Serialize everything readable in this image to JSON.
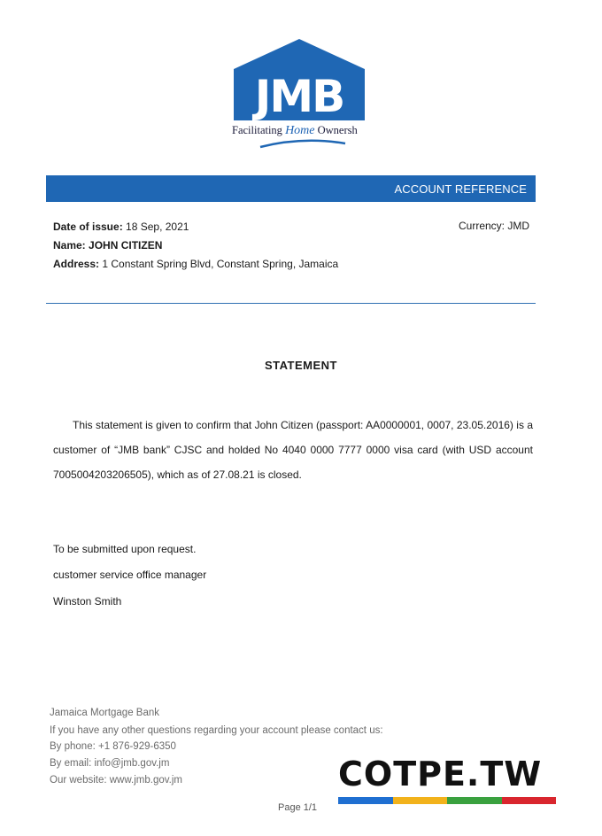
{
  "logo": {
    "text": "JMB",
    "tagline_before": "Facilitating",
    "tagline_home": "Home",
    "tagline_after": "Ownersh",
    "color": "#1f67b4"
  },
  "header": {
    "title": "ACCOUNT REFERENCE",
    "color": "#1f67b4"
  },
  "meta": {
    "date_label": "Date of issue:",
    "date_value": "18 Sep, 2021",
    "name_label": "Name:",
    "name_value": "JOHN CITIZEN",
    "address_label": "Address:",
    "address_value": "1 Constant Spring Blvd, Constant Spring, Jamaica",
    "currency": "Currency: JMD"
  },
  "statement": {
    "title": "STATEMENT",
    "body": "This statement is given to confirm that John Citizen (passport: AA0000001, 0007, 23.05.2016) is a customer of “JMB bank” CJSC and holded No 4040 0000 7777 0000 visa card (with USD account 7005004203206505), which as of 27.08.21 is closed."
  },
  "signature": {
    "line1": "To be submitted upon request.",
    "line2": "customer service office manager",
    "line3": "Winston Smith"
  },
  "footer": {
    "bank": "Jamaica Mortgage Bank",
    "questions": "If you have any other questions regarding your account please contact us:",
    "phone": "By phone: +1 876-929-6350",
    "email": "By email: info@jmb.gov.jm",
    "website": "Our website: www.jmb.gov.jm"
  },
  "page": "Page 1/1",
  "watermark": {
    "text": "COTPE.TW",
    "stripe_colors": [
      "#1f6fd1",
      "#f2b21b",
      "#3aa13f",
      "#d9262e"
    ]
  }
}
